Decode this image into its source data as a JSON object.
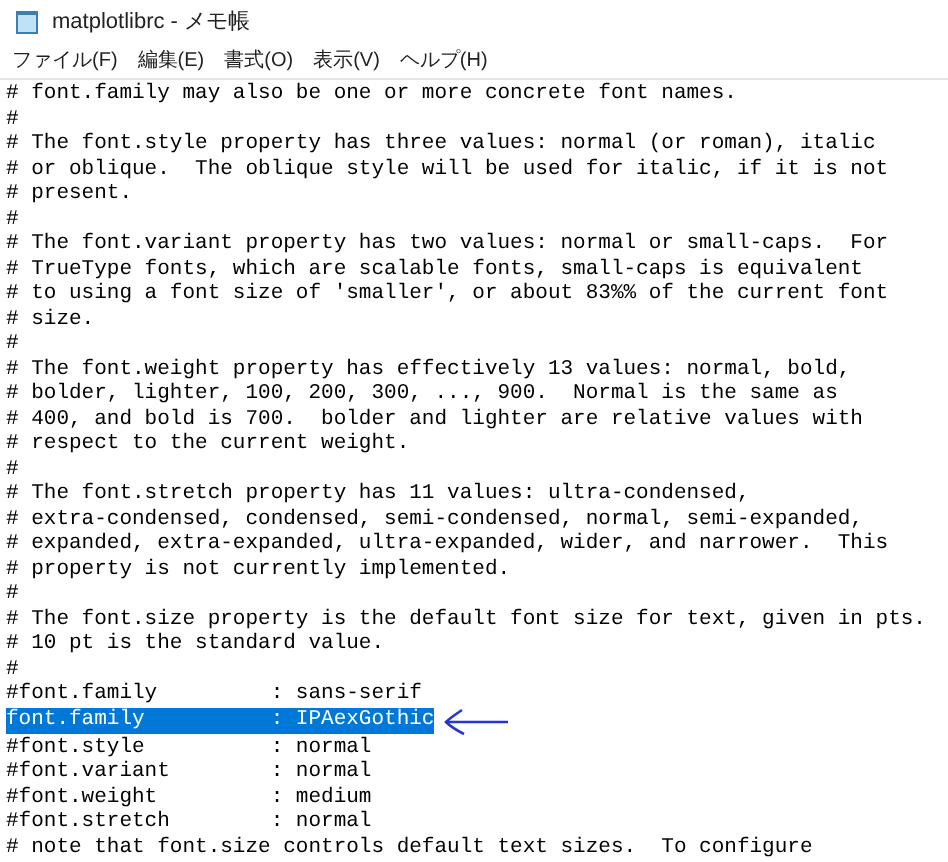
{
  "window": {
    "title": "matplotlibrc - メモ帳"
  },
  "menu": [
    "ファイル(F)",
    "編集(E)",
    "書式(O)",
    "表示(V)",
    "ヘルプ(H)"
  ],
  "lines": [
    {
      "text": "# font.family may also be one or more concrete font names.",
      "selected": false
    },
    {
      "text": "#",
      "selected": false
    },
    {
      "text": "# The font.style property has three values: normal (or roman), italic",
      "selected": false
    },
    {
      "text": "# or oblique.  The oblique style will be used for italic, if it is not",
      "selected": false
    },
    {
      "text": "# present.",
      "selected": false
    },
    {
      "text": "#",
      "selected": false
    },
    {
      "text": "# The font.variant property has two values: normal or small-caps.  For",
      "selected": false
    },
    {
      "text": "# TrueType fonts, which are scalable fonts, small-caps is equivalent",
      "selected": false
    },
    {
      "text": "# to using a font size of 'smaller', or about 83%% of the current font",
      "selected": false
    },
    {
      "text": "# size.",
      "selected": false
    },
    {
      "text": "#",
      "selected": false
    },
    {
      "text": "# The font.weight property has effectively 13 values: normal, bold,",
      "selected": false
    },
    {
      "text": "# bolder, lighter, 100, 200, 300, ..., 900.  Normal is the same as",
      "selected": false
    },
    {
      "text": "# 400, and bold is 700.  bolder and lighter are relative values with",
      "selected": false
    },
    {
      "text": "# respect to the current weight.",
      "selected": false
    },
    {
      "text": "#",
      "selected": false
    },
    {
      "text": "# The font.stretch property has 11 values: ultra-condensed,",
      "selected": false
    },
    {
      "text": "# extra-condensed, condensed, semi-condensed, normal, semi-expanded,",
      "selected": false
    },
    {
      "text": "# expanded, extra-expanded, ultra-expanded, wider, and narrower.  This",
      "selected": false
    },
    {
      "text": "# property is not currently implemented.",
      "selected": false
    },
    {
      "text": "#",
      "selected": false
    },
    {
      "text": "# The font.size property is the default font size for text, given in pts.",
      "selected": false
    },
    {
      "text": "# 10 pt is the standard value.",
      "selected": false
    },
    {
      "text": "#",
      "selected": false
    },
    {
      "text": "#font.family         : sans-serif",
      "selected": false
    },
    {
      "text": "font.family          : IPAexGothic",
      "selected": true
    },
    {
      "text": "#font.style          : normal",
      "selected": false
    },
    {
      "text": "#font.variant        : normal",
      "selected": false
    },
    {
      "text": "#font.weight         : medium",
      "selected": false
    },
    {
      "text": "#font.stretch        : normal",
      "selected": false
    },
    {
      "text": "# note that font.size controls default text sizes.  To configure",
      "selected": false
    }
  ]
}
